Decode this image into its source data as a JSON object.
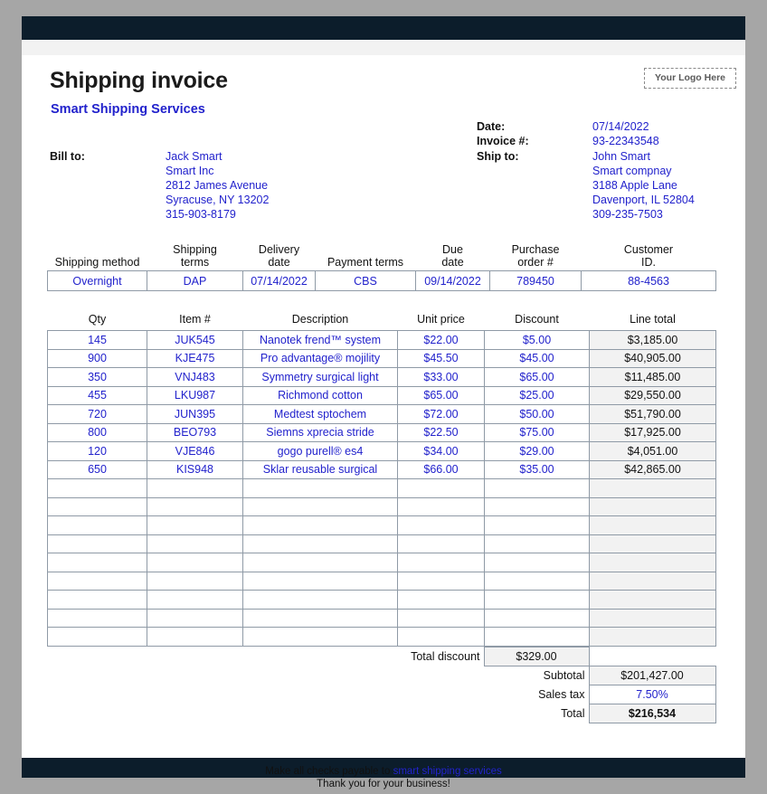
{
  "document": {
    "title": "Shipping invoice",
    "company": "Smart Shipping Services",
    "logo_placeholder": "Your Logo Here"
  },
  "meta": {
    "date_label": "Date:",
    "date_value": "07/14/2022",
    "invoice_label": "Invoice #:",
    "invoice_value": "93-22343548"
  },
  "bill_to": {
    "label": "Bill to:",
    "name": "Jack Smart",
    "company": "Smart Inc",
    "street": "2812 James Avenue",
    "city": "Syracuse, NY 13202",
    "phone": "315-903-8179"
  },
  "ship_to": {
    "label": "Ship to:",
    "name": "John Smart",
    "company": "Smart compnay",
    "street": "3188 Apple Lane",
    "city": "Davenport, IL 52804",
    "phone": "309-235-7503"
  },
  "shipping": {
    "headers": [
      "Shipping method",
      "Shipping\nterms",
      "Delivery\ndate",
      "Payment terms",
      "Due\ndate",
      "Purchase\norder #",
      "Customer\nID."
    ],
    "header_method": "Shipping method",
    "header_terms_l1": "Shipping",
    "header_terms_l2": "terms",
    "header_delivery_l1": "Delivery",
    "header_delivery_l2": "date",
    "header_payment": "Payment terms",
    "header_due_l1": "Due",
    "header_due_l2": "date",
    "header_po_l1": "Purchase",
    "header_po_l2": "order #",
    "header_cust_l1": "Customer",
    "header_cust_l2": "ID.",
    "values": {
      "method": "Overnight",
      "terms": "DAP",
      "delivery_date": "07/14/2022",
      "payment_terms": "CBS",
      "due_date": "09/14/2022",
      "purchase_order": "789450",
      "customer_id": "88-4563"
    }
  },
  "items": {
    "headers": {
      "qty": "Qty",
      "item": "Item #",
      "description": "Description",
      "unit_price": "Unit price",
      "discount": "Discount",
      "line_total": "Line total"
    },
    "rows": [
      {
        "qty": "145",
        "item": "JUK545",
        "description": "Nanotek frend™ system",
        "unit_price": "$22.00",
        "discount": "$5.00",
        "line_total": "$3,185.00"
      },
      {
        "qty": "900",
        "item": "KJE475",
        "description": "Pro advantage® mojility",
        "unit_price": "$45.50",
        "discount": "$45.00",
        "line_total": "$40,905.00"
      },
      {
        "qty": "350",
        "item": "VNJ483",
        "description": "Symmetry surgical light",
        "unit_price": "$33.00",
        "discount": "$65.00",
        "line_total": "$11,485.00"
      },
      {
        "qty": "455",
        "item": "LKU987",
        "description": "Richmond cotton",
        "unit_price": "$65.00",
        "discount": "$25.00",
        "line_total": "$29,550.00"
      },
      {
        "qty": "720",
        "item": "JUN395",
        "description": "Medtest sptochem",
        "unit_price": "$72.00",
        "discount": "$50.00",
        "line_total": "$51,790.00"
      },
      {
        "qty": "800",
        "item": "BEO793",
        "description": "Siemns xprecia stride",
        "unit_price": "$22.50",
        "discount": "$75.00",
        "line_total": "$17,925.00"
      },
      {
        "qty": "120",
        "item": "VJE846",
        "description": "gogo purell® es4",
        "unit_price": "$34.00",
        "discount": "$29.00",
        "line_total": "$4,051.00"
      },
      {
        "qty": "650",
        "item": "KIS948",
        "description": "Sklar reusable surgical",
        "unit_price": "$66.00",
        "discount": "$35.00",
        "line_total": "$42,865.00"
      }
    ],
    "blank_row_count": 9
  },
  "totals": {
    "total_discount_label": "Total discount",
    "total_discount_value": "$329.00",
    "subtotal_label": "Subtotal",
    "subtotal_value": "$201,427.00",
    "sales_tax_label": "Sales tax",
    "sales_tax_value": "7.50%",
    "total_label": "Total",
    "total_value": "$216,534"
  },
  "footer": {
    "line1_prefix": "Make all checks payable to ",
    "line1_link": "smart shipping services",
    "line2": "Thank you for your business!"
  },
  "colors": {
    "accent_blue": "#2222cc",
    "bar_navy": "#0c1d2b",
    "shade_gray": "#f2f2f2",
    "page_bg": "#a6a6a6",
    "grid_line": "#8f9aa6"
  }
}
